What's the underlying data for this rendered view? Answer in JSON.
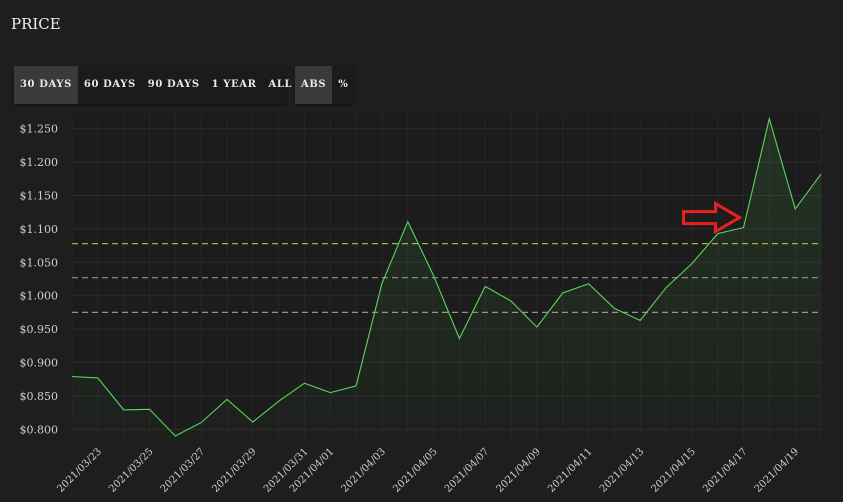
{
  "header": {
    "title": "PRICE"
  },
  "range_buttons": [
    {
      "label": "30 DAYS",
      "active": true
    },
    {
      "label": "60 DAYS",
      "active": false
    },
    {
      "label": "90 DAYS",
      "active": false
    },
    {
      "label": "1 YEAR",
      "active": false
    },
    {
      "label": "ALL",
      "active": false
    }
  ],
  "mode_buttons": [
    {
      "label": "ABS",
      "active": true
    },
    {
      "label": "%",
      "active": false
    }
  ],
  "colors": {
    "line": "#5bd65b",
    "reference_upper": "#c9c83a",
    "reference_mid": "#a8a8a8",
    "annotation_arrow": "#e82020"
  },
  "chart_data": {
    "type": "area",
    "x": [
      "2021/03/22",
      "2021/03/23",
      "2021/03/24",
      "2021/03/25",
      "2021/03/26",
      "2021/03/27",
      "2021/03/28",
      "2021/03/29",
      "2021/03/30",
      "2021/03/31",
      "2021/04/01",
      "2021/04/02",
      "2021/04/03",
      "2021/04/04",
      "2021/04/05",
      "2021/04/06",
      "2021/04/07",
      "2021/04/08",
      "2021/04/09",
      "2021/04/10",
      "2021/04/11",
      "2021/04/12",
      "2021/04/13",
      "2021/04/14",
      "2021/04/15",
      "2021/04/16",
      "2021/04/17",
      "2021/04/18",
      "2021/04/19",
      "2021/04/20"
    ],
    "series": [
      {
        "values": [
          0.879,
          0.877,
          0.829,
          0.83,
          0.79,
          0.81,
          0.845,
          0.811,
          0.842,
          0.869,
          0.855,
          0.865,
          1.018,
          1.111,
          1.03,
          0.936,
          1.014,
          0.992,
          0.953,
          1.004,
          1.018,
          0.981,
          0.963,
          1.012,
          1.048,
          1.093,
          1.102,
          1.265,
          1.13,
          1.182
        ]
      }
    ],
    "x_tick_labels": [
      "2021/03/23",
      "2021/03/25",
      "2021/03/27",
      "2021/03/29",
      "2021/03/31",
      "2021/04/01",
      "2021/04/03",
      "2021/04/05",
      "2021/04/07",
      "2021/04/09",
      "2021/04/11",
      "2021/04/13",
      "2021/04/15",
      "2021/04/17",
      "2021/04/19"
    ],
    "y_tick_labels": [
      "$0.800",
      "$0.850",
      "$0.900",
      "$0.950",
      "$1.000",
      "$1.050",
      "$1.100",
      "$1.150",
      "$1.200",
      "$1.250"
    ],
    "ylim": [
      0.787,
      1.272
    ],
    "reference_lines": [
      {
        "value": 1.078,
        "style": "yellow-dashed"
      },
      {
        "value": 1.027,
        "style": "grey-dashed"
      },
      {
        "value": 0.975,
        "style": "grey-dashed"
      }
    ],
    "annotation": {
      "shape": "arrow-right",
      "x": "2021/04/17",
      "y": 1.102
    },
    "grid": true,
    "legend": "none"
  }
}
